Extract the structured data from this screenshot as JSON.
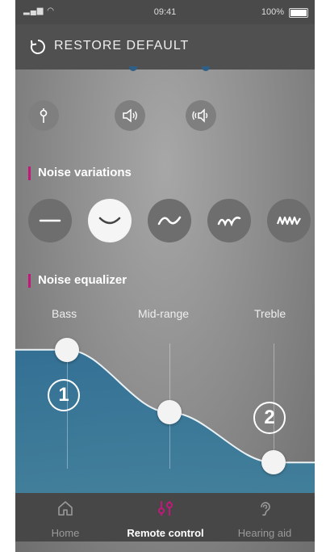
{
  "status_bar": {
    "time": "09:41",
    "battery": "100%"
  },
  "header": {
    "restore_label": "RESTORE DEFAULT"
  },
  "controls": [
    {
      "icon": "tuning-fork-icon"
    },
    {
      "icon": "speaker-icon"
    },
    {
      "icon": "stereo-speaker-icon"
    }
  ],
  "noise_variations": {
    "title": "Noise variations",
    "options": [
      "flat-wave-icon",
      "single-curve-icon",
      "double-wave-icon",
      "triple-wave-icon",
      "dense-wave-icon"
    ],
    "selected_index": 1
  },
  "noise_equalizer": {
    "title": "Noise equalizer",
    "bands": [
      {
        "label": "Bass",
        "level": 0.95
      },
      {
        "label": "Mid-range",
        "level": 0.45
      },
      {
        "label": "Treble",
        "level": 0.05
      }
    ]
  },
  "annotations": {
    "step1": "1",
    "step2": "2"
  },
  "tabbar": {
    "items": [
      {
        "label": "Home",
        "icon": "home-icon"
      },
      {
        "label": "Remote control",
        "icon": "sliders-icon"
      },
      {
        "label": "Hearing aid",
        "icon": "ear-icon"
      }
    ],
    "active_index": 1
  },
  "colors": {
    "accent": "#c2187a",
    "fill": "#2f6f95",
    "background": "#8e8e8e"
  }
}
